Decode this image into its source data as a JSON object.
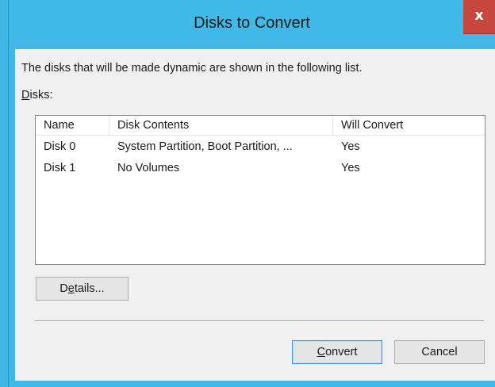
{
  "window": {
    "title": "Disks to Convert",
    "close_glyph": "x"
  },
  "dialog": {
    "description": "The disks that will be made dynamic are shown in the following list.",
    "disks_label_mnemonic": "D",
    "disks_label_rest": "isks:"
  },
  "list": {
    "columns": [
      "Name",
      "Disk Contents",
      "Will Convert"
    ],
    "rows": [
      {
        "name": "Disk 0",
        "contents": "System Partition, Boot Partition, ...",
        "convert": "Yes"
      },
      {
        "name": "Disk 1",
        "contents": "No Volumes",
        "convert": "Yes"
      }
    ]
  },
  "buttons": {
    "details_pre": "D",
    "details_mnemonic": "e",
    "details_post": "tails...",
    "convert_mnemonic": "C",
    "convert_post": "onvert",
    "cancel_label": "Cancel"
  },
  "colors": {
    "frame": "#40b9e8",
    "close": "#c7473f",
    "client": "#f0f0f0",
    "default_button_border": "#3399ff"
  }
}
